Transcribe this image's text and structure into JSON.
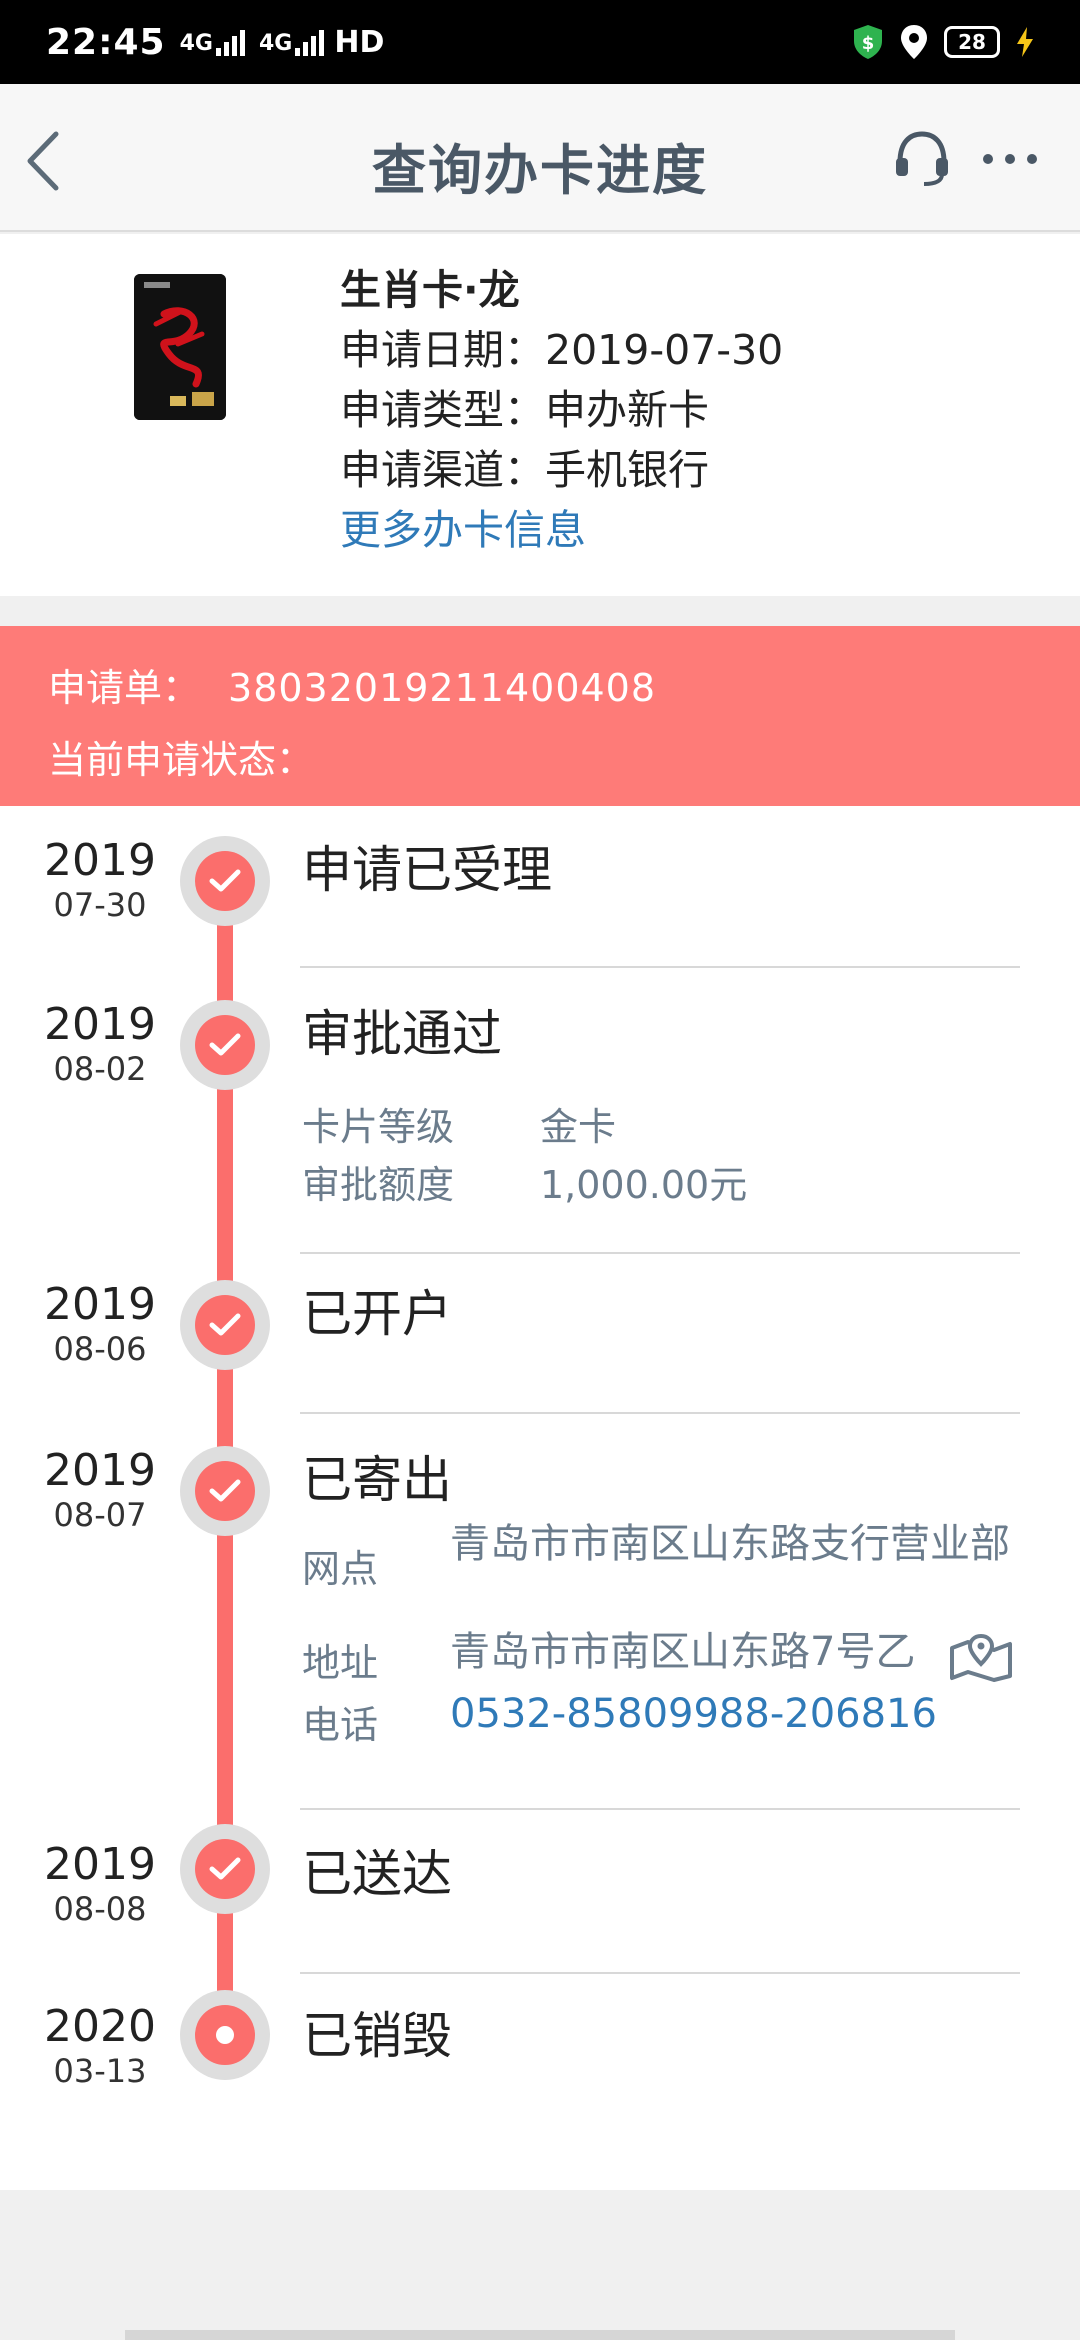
{
  "status_bar": {
    "time": "22:45",
    "network1": "4G",
    "network2": "4G",
    "hd": "HD",
    "battery": "28"
  },
  "nav": {
    "title": "查询办卡进度"
  },
  "card": {
    "name": "生肖卡·龙",
    "apply_date": "申请日期：2019-07-30",
    "apply_type": "申请类型：申办新卡",
    "apply_channel": "申请渠道：手机银行",
    "more_info": "更多办卡信息"
  },
  "application": {
    "label": "申请单：",
    "number": "38032019211400408",
    "status_label": "当前申请状态："
  },
  "timeline": [
    {
      "year": "2019",
      "md": "07-30",
      "status": "申请已受理"
    },
    {
      "year": "2019",
      "md": "08-02",
      "status": "审批通过",
      "details": [
        {
          "k": "卡片等级",
          "v": "金卡"
        },
        {
          "k": "审批额度",
          "v": "1,000.00元"
        }
      ]
    },
    {
      "year": "2019",
      "md": "08-06",
      "status": "已开户"
    },
    {
      "year": "2019",
      "md": "08-07",
      "status": "已寄出",
      "details": [
        {
          "k": "网点",
          "v": "青岛市市南区山东路支行营业部"
        },
        {
          "k": "地址",
          "v": "青岛市市南区山东路7号乙"
        },
        {
          "k": "电话",
          "v": "0532-85809988-206816"
        }
      ]
    },
    {
      "year": "2019",
      "md": "08-08",
      "status": "已送达"
    },
    {
      "year": "2020",
      "md": "03-13",
      "status": "已销毁"
    }
  ],
  "colors": {
    "accent": "#fb6e6c",
    "link": "#2f7ab8",
    "title": "#4a5866"
  }
}
